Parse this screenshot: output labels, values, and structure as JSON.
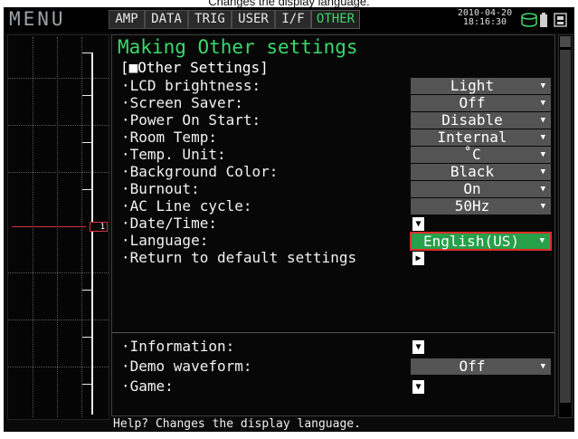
{
  "caption": "Changes the display language.",
  "topbar": {
    "menu_label": "MENU",
    "tabs": [
      {
        "label": "AMP",
        "active": false
      },
      {
        "label": "DATA",
        "active": false
      },
      {
        "label": "TRIG",
        "active": false
      },
      {
        "label": "USER",
        "active": false
      },
      {
        "label": "I/F",
        "active": false
      },
      {
        "label": "OTHER",
        "active": true
      }
    ],
    "date": "2010-04-20",
    "time": "18:16:30",
    "status_icons": [
      "storage-icon",
      "battery-icon",
      "memory-card-icon"
    ]
  },
  "preview": {
    "channel_marker": "1"
  },
  "panel": {
    "title": "Making Other settings",
    "section": "[■Other Settings]",
    "settings": [
      {
        "label": "·LCD brightness:",
        "value": "Light",
        "type": "dropdown"
      },
      {
        "label": "·Screen Saver:",
        "value": "Off",
        "type": "dropdown"
      },
      {
        "label": "·Power On Start:",
        "value": "Disable",
        "type": "dropdown"
      },
      {
        "label": "·Room Temp:",
        "value": "Internal",
        "type": "dropdown"
      },
      {
        "label": "·Temp. Unit:",
        "value": "˚C",
        "type": "dropdown"
      },
      {
        "label": "·Background Color:",
        "value": "Black",
        "type": "dropdown"
      },
      {
        "label": "·Burnout:",
        "value": "On",
        "type": "dropdown"
      },
      {
        "label": "·AC Line cycle:",
        "value": "50Hz",
        "type": "dropdown"
      },
      {
        "label": "·Date/Time:",
        "value": "",
        "type": "expand"
      },
      {
        "label": "·Language:",
        "value": "English(US)",
        "type": "dropdown-selected"
      },
      {
        "label": "·Return to default settings",
        "value": "",
        "type": "execute"
      }
    ],
    "extras": [
      {
        "label": "·Information:",
        "value": "",
        "type": "expand"
      },
      {
        "label": "·Demo waveform:",
        "value": "Off",
        "type": "dropdown"
      },
      {
        "label": "·Game:",
        "value": "",
        "type": "expand"
      }
    ]
  },
  "help_text": "Help? Changes the display language.",
  "colors": {
    "accent_green": "#3ad86b",
    "dropdown_gray": "#545454",
    "selected_green": "#27a04a",
    "selection_border": "#e02a2a",
    "trace_red": "#d43040"
  }
}
